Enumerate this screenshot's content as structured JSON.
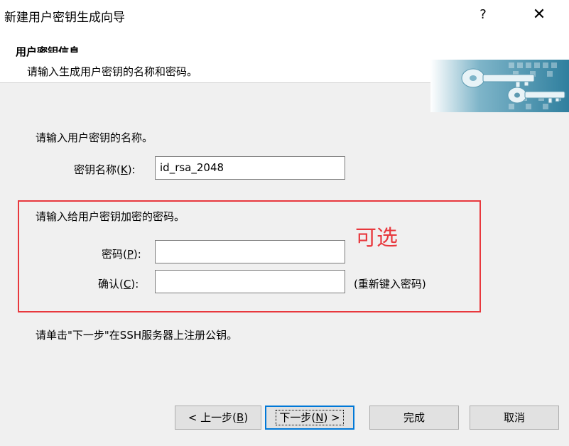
{
  "window": {
    "title": "新建用户密钥生成向导",
    "help_label": "?",
    "close_label": "✕"
  },
  "header": {
    "title": "用户密钥信息",
    "subtitle": "请输入生成用户密钥的名称和密码。"
  },
  "name_section": {
    "prompt": "请输入用户密钥的名称。",
    "label_text": "密钥名称(",
    "label_key": "K",
    "label_end": "):",
    "value": "id_rsa_2048"
  },
  "password_section": {
    "prompt": "请输入给用户密钥加密的密码。",
    "optional_note": "可选",
    "password_label_text": "密码(",
    "password_label_key": "P",
    "password_label_end": "):",
    "password_value": "",
    "confirm_label_text": "确认(",
    "confirm_label_key": "C",
    "confirm_label_end": "):",
    "confirm_value": "",
    "confirm_hint": "(重新键入密码)"
  },
  "footer_note": "请单击\"下一步\"在SSH服务器上注册公钥。",
  "buttons": {
    "back_text": "< 上一步(",
    "back_key": "B",
    "back_end": ")",
    "next_text": "下一步(",
    "next_key": "N",
    "next_end": ") >",
    "finish": "完成",
    "cancel": "取消"
  },
  "colors": {
    "highlight_border": "#e8383d",
    "default_button_border": "#0078d7",
    "key_art": "#2f7f9e"
  },
  "icons": {
    "header_art": "keys-icon"
  }
}
